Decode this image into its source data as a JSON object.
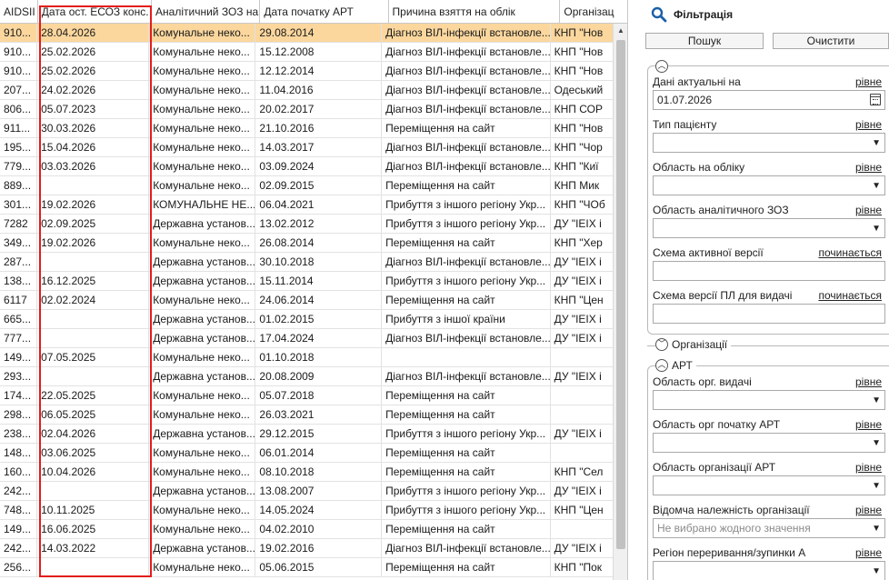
{
  "grid": {
    "columns": [
      "AIDSII",
      "Дата ост. ЕСОЗ конс.",
      "Аналітичний ЗОЗ на",
      "Дата початку АРТ",
      "Причина взяття на облік",
      "Організац"
    ],
    "rows": [
      [
        "910...",
        "28.04.2026",
        "Комунальне неко...",
        "29.08.2014",
        "Діагноз ВІЛ-інфекції встановле...",
        "КНП \"Нов"
      ],
      [
        "910...",
        "25.02.2026",
        "Комунальне неко...",
        "15.12.2008",
        "Діагноз ВІЛ-інфекції встановле...",
        "КНП \"Нов"
      ],
      [
        "910...",
        "25.02.2026",
        "Комунальне неко...",
        "12.12.2014",
        "Діагноз ВІЛ-інфекції встановле...",
        "КНП \"Нов"
      ],
      [
        "207...",
        "24.02.2026",
        "Комунальне неко...",
        "11.04.2016",
        "Діагноз ВІЛ-інфекції встановле...",
        "Одеський"
      ],
      [
        "806...",
        "05.07.2023",
        "Комунальне неко...",
        "20.02.2017",
        "Діагноз ВІЛ-інфекції встановле...",
        "КНП СОР"
      ],
      [
        "911...",
        "30.03.2026",
        "Комунальне неко...",
        "21.10.2016",
        "Переміщення на сайт",
        "КНП \"Нов"
      ],
      [
        "195...",
        "15.04.2026",
        "Комунальне неко...",
        "14.03.2017",
        "Діагноз ВІЛ-інфекції встановле...",
        "КНП \"Чор"
      ],
      [
        "779...",
        "03.03.2026",
        "Комунальне неко...",
        "03.09.2024",
        "Діагноз ВІЛ-інфекції встановле...",
        "КНП \"Киї"
      ],
      [
        "889...",
        "",
        "Комунальне неко...",
        "02.09.2015",
        "Переміщення на сайт",
        "КНП Мик"
      ],
      [
        "301...",
        "19.02.2026",
        "КОМУНАЛЬНЕ НЕ...",
        "06.04.2021",
        "Прибуття з іншого регіону Укр...",
        "КНП \"ЧОб"
      ],
      [
        "7282",
        "02.09.2025",
        "Державна установ...",
        "13.02.2012",
        "Прибуття з іншого регіону Укр...",
        "ДУ \"ІЕІХ і"
      ],
      [
        "349...",
        "19.02.2026",
        "Комунальне неко...",
        "26.08.2014",
        "Переміщення на сайт",
        "КНП \"Хер"
      ],
      [
        "287...",
        "",
        "Державна установ...",
        "30.10.2018",
        "Діагноз ВІЛ-інфекції встановле...",
        "ДУ \"ІЕІХ і"
      ],
      [
        "138...",
        "16.12.2025",
        "Державна установ...",
        "15.11.2014",
        "Прибуття з іншого регіону Укр...",
        "ДУ \"ІЕІХ і"
      ],
      [
        "6117",
        "02.02.2024",
        "Комунальне неко...",
        "24.06.2014",
        "Переміщення на сайт",
        "КНП \"Цен"
      ],
      [
        "665...",
        "",
        "Державна установ...",
        "01.02.2015",
        "Прибуття з іншої країни",
        "ДУ \"ІЕІХ і"
      ],
      [
        "777...",
        "",
        "Державна установ...",
        "17.04.2024",
        "Діагноз ВІЛ-інфекції встановле...",
        "ДУ \"ІЕІХ і"
      ],
      [
        "149...",
        "07.05.2025",
        "Комунальне неко...",
        "01.10.2018",
        "",
        ""
      ],
      [
        "293...",
        "",
        "Державна установ...",
        "20.08.2009",
        "Діагноз ВІЛ-інфекції встановле...",
        "ДУ \"ІЕІХ і"
      ],
      [
        "174...",
        "22.05.2025",
        "Комунальне неко...",
        "05.07.2018",
        "Переміщення на сайт",
        ""
      ],
      [
        "298...",
        "06.05.2025",
        "Комунальне неко...",
        "26.03.2021",
        "Переміщення на сайт",
        ""
      ],
      [
        "238...",
        "02.04.2026",
        "Державна установ...",
        "29.12.2015",
        "Прибуття з іншого регіону Укр...",
        "ДУ \"ІЕІХ і"
      ],
      [
        "148...",
        "03.06.2025",
        "Комунальне неко...",
        "06.01.2014",
        "Переміщення на сайт",
        ""
      ],
      [
        "160...",
        "10.04.2026",
        "Комунальне неко...",
        "08.10.2018",
        "Переміщення на сайт",
        "КНП \"Сел"
      ],
      [
        "242...",
        "",
        "Державна установ...",
        "13.08.2007",
        "Прибуття з іншого регіону Укр...",
        "ДУ \"ІЕІХ і"
      ],
      [
        "748...",
        "10.11.2025",
        "Комунальне неко...",
        "14.05.2024",
        "Прибуття з іншого регіону Укр...",
        "КНП \"Цен"
      ],
      [
        "149...",
        "16.06.2025",
        "Комунальне неко...",
        "04.02.2010",
        "Переміщення на сайт",
        ""
      ],
      [
        "242...",
        "14.03.2022",
        "Державна установ...",
        "19.02.2016",
        "Діагноз ВІЛ-інфекції встановле...",
        "ДУ \"ІЕІХ і"
      ],
      [
        "256...",
        "",
        "Комунальне неко...",
        "05.06.2015",
        "Переміщення на сайт",
        "КНП \"Пок"
      ]
    ]
  },
  "panel": {
    "title": "Фільтрація",
    "search_button": "Пошук",
    "clear_button": "Очистити",
    "fields": [
      {
        "label": "Дані актуальні на",
        "op": "рівне",
        "value": "01.07.2026",
        "kind": "date"
      },
      {
        "label": "Тип пацієнту",
        "op": "рівне",
        "value": "",
        "kind": "select"
      },
      {
        "label": "Область на обліку",
        "op": "рівне",
        "value": "",
        "kind": "select"
      },
      {
        "label": "Область аналітичного ЗОЗ",
        "op": "рівне",
        "value": "",
        "kind": "select"
      },
      {
        "label": "Схема активної версії",
        "op": "починається",
        "value": "",
        "kind": "text"
      },
      {
        "label": "Схема версії ПЛ для видачі",
        "op": "починається",
        "value": "",
        "kind": "text"
      }
    ],
    "org_section": "Організації",
    "art_section": "АРТ",
    "art_fields": [
      {
        "label": "Область орг. видачі",
        "op": "рівне",
        "value": ""
      },
      {
        "label": "Область орг початку АРТ",
        "op": "рівне",
        "value": ""
      },
      {
        "label": "Область організації АРТ",
        "op": "рівне",
        "value": ""
      },
      {
        "label": "Відомча належність організації",
        "op": "рівне",
        "placeholder": "Не вибрано жодного значення"
      },
      {
        "label": "Регіон переривання/зупинки А",
        "op": "рівне",
        "value": ""
      }
    ]
  }
}
